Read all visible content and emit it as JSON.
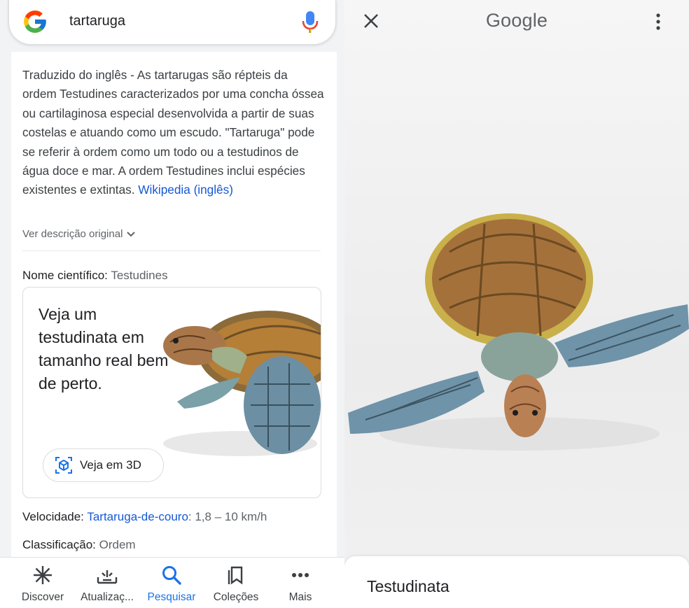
{
  "left": {
    "search": {
      "query": "tartaruga"
    },
    "description": {
      "text": "Traduzido do inglês - As tartarugas são répteis da ordem Testudines caracterizados por uma concha óssea ou cartilaginosa especial desenvolvida a partir de suas costelas e atuando como um escudo. \"Tartaruga\" pode se referir à ordem como um todo ou a testudinos de água doce e mar. A ordem Testudines inclui espécies existentes e extintas. ",
      "source_link": "Wikipedia (inglês)",
      "original_toggle": "Ver descrição original"
    },
    "scientific_name": {
      "label": "Nome científico:",
      "value": "Testudines"
    },
    "ar_card": {
      "title": "Veja um testudinata em tamanho real bem de perto.",
      "button_label": "Veja em 3D"
    },
    "facts": {
      "speed_label": "Velocidade:",
      "speed_link": "Tartaruga-de-couro",
      "speed_value": ": 1,8 – 10 km/h",
      "class_label": "Classificação:",
      "class_value": "Ordem"
    },
    "nav": [
      {
        "label": "Discover",
        "icon": "asterisk-icon"
      },
      {
        "label": "Atualizaç...",
        "icon": "updates-icon"
      },
      {
        "label": "Pesquisar",
        "icon": "search-icon",
        "active": true
      },
      {
        "label": "Coleções",
        "icon": "collections-icon"
      },
      {
        "label": "Mais",
        "icon": "more-horizontal-icon"
      }
    ],
    "colors": {
      "link": "#1558d6",
      "active": "#1a73e8"
    }
  },
  "right": {
    "brand": "Google",
    "sheet_title": "Testudinata"
  }
}
